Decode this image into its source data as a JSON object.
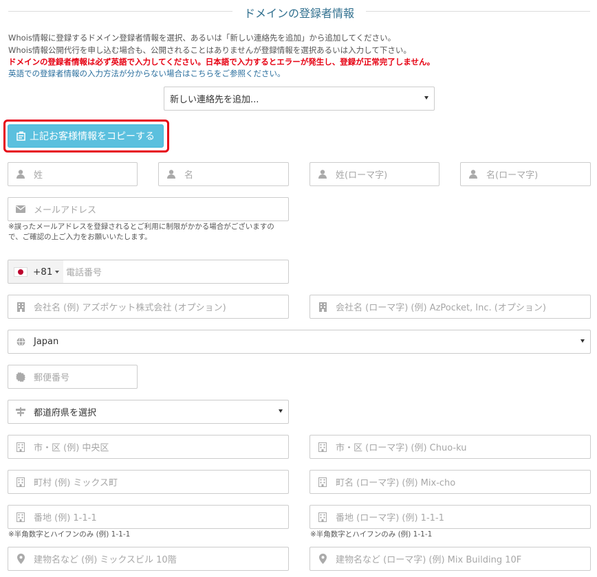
{
  "section": {
    "title": "ドメインの登録者情報"
  },
  "notes": {
    "line1": "Whois情報に登録するドメイン登録者情報を選択、あるいは「新しい連絡先を追加」から追加してください。",
    "line2": "Whois情報公開代行を申し込む場合も、公開されることはありませんが登録情報を選択あるいは入力して下さい。",
    "warning": "ドメインの登録者情報は必ず英語で入力してください。日本語で入力するとエラーが発生し、登録が正常完了しません。",
    "help_link": "英語での登録者情報の入力方法が分からない場合はこちらをご参照ください。"
  },
  "contact_select": {
    "value": "新しい連絡先を追加..."
  },
  "copy_button": {
    "label": "上記お客様情報をコピーする"
  },
  "fields": {
    "last_name": "姓",
    "first_name": "名",
    "last_name_roman": "姓(ローマ字)",
    "first_name_roman": "名(ローマ字)",
    "email": "メールアドレス",
    "email_hint_1": "※誤ったメールアドレスを登録されるとご利用に制限がかかる場合がございますの",
    "email_hint_2": "で、ご確認の上ご入力をお願いいたします。",
    "phone_code": "+81",
    "phone": "電話番号",
    "company": "会社名 (例) アズポケット株式会社 (オプション)",
    "company_roman": "会社名 (ローマ字) (例) AzPocket, Inc. (オプション)",
    "country": "Japan",
    "zip": "郵便番号",
    "prefecture": "都道府県を選択",
    "city": "市・区 (例) 中央区",
    "city_roman": "市・区 (ローマ字) (例) Chuo-ku",
    "town": "町村 (例) ミックス町",
    "town_roman": "町名 (ローマ字) (例) Mix-cho",
    "address": "番地 (例) 1-1-1",
    "address_roman": "番地 (ローマ字) (例) 1-1-1",
    "address_hint": "※半角数字とハイフンのみ (例) 1-1-1",
    "address_roman_hint": "※半角数字とハイフンのみ (例) 1-1-1",
    "building": "建物名など (例) ミックスビル 10階",
    "building_roman": "建物名など (ローマ字) (例) Mix Building 10F"
  },
  "colors": {
    "accent": "#5bc0de",
    "warning": "#e60012",
    "link": "#2b6f9e",
    "title": "#31708f"
  }
}
